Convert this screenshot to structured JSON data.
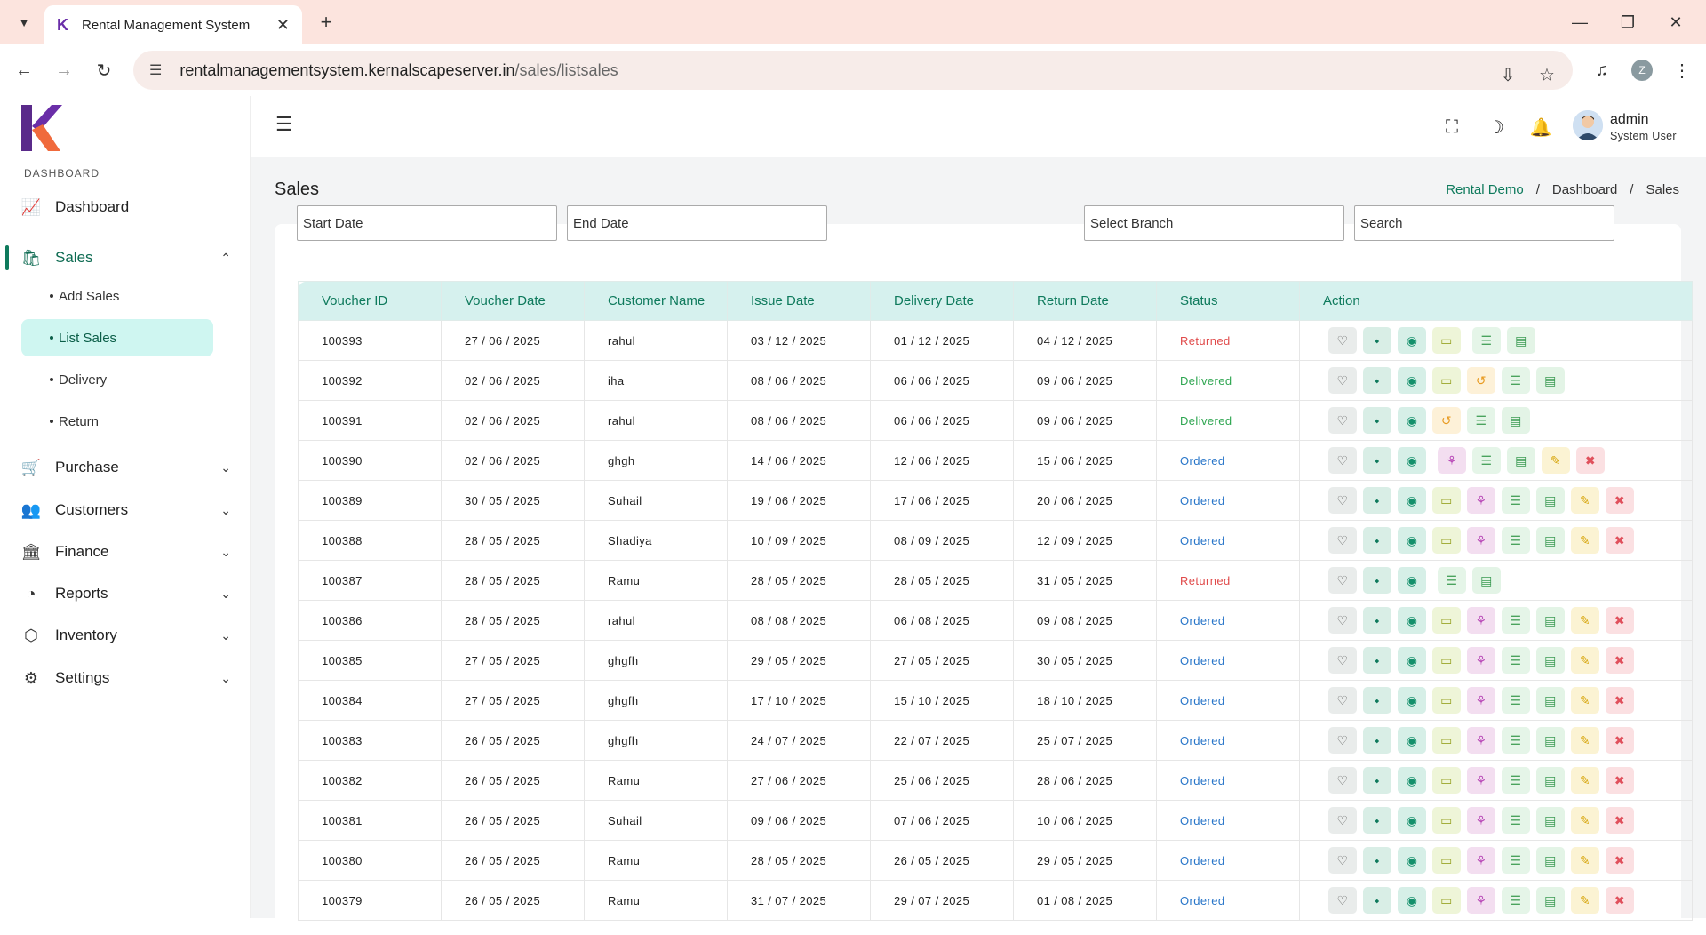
{
  "browser": {
    "tab_title": "Rental Management System",
    "url_host": "rentalmanagementsystem.kernalscapeserver.in",
    "url_path": "/sales/listsales",
    "profile_initial": "Z"
  },
  "sidebar": {
    "section_label": "DASHBOARD",
    "items": [
      {
        "label": "Dashboard",
        "icon": "chart-icon"
      },
      {
        "label": "Sales",
        "icon": "bag-icon",
        "expanded": true
      },
      {
        "label": "Purchase",
        "icon": "cart-icon"
      },
      {
        "label": "Customers",
        "icon": "users-icon"
      },
      {
        "label": "Finance",
        "icon": "bank-icon"
      },
      {
        "label": "Reports",
        "icon": "pie-icon"
      },
      {
        "label": "Inventory",
        "icon": "box-icon"
      },
      {
        "label": "Settings",
        "icon": "gear-icon"
      }
    ],
    "sales_sub": [
      "Add Sales",
      "List Sales",
      "Delivery",
      "Return"
    ]
  },
  "topbar": {
    "user_name": "admin",
    "user_role": "System User"
  },
  "page": {
    "title": "Sales",
    "breadcrumb": [
      "Rental Demo",
      "Dashboard",
      "Sales"
    ]
  },
  "filters": {
    "start_date": "Start Date",
    "end_date": "End Date",
    "branch": "Select Branch",
    "search": "Search"
  },
  "table": {
    "columns": [
      "Voucher ID",
      "Voucher Date",
      "Customer Name",
      "Issue Date",
      "Delivery Date",
      "Return Date",
      "Status",
      "Action"
    ],
    "rows": [
      {
        "id": "100393",
        "vdate": "27 / 06 / 2025",
        "customer": "rahul",
        "issue": "03 / 12 / 2025",
        "delivery": "01 / 12 / 2025",
        "ret": "04 / 12 / 2025",
        "status": "Returned",
        "actions": [
          "like",
          "share",
          "view",
          "pay",
          "gap",
          "list",
          "doc"
        ]
      },
      {
        "id": "100392",
        "vdate": "02 / 06 / 2025",
        "customer": "iha",
        "issue": "08 / 06 / 2025",
        "delivery": "06 / 06 / 2025",
        "ret": "09 / 06 / 2025",
        "status": "Delivered",
        "actions": [
          "like",
          "share",
          "view",
          "pay",
          "return",
          "list",
          "doc"
        ]
      },
      {
        "id": "100391",
        "vdate": "02 / 06 / 2025",
        "customer": "rahul",
        "issue": "08 / 06 / 2025",
        "delivery": "06 / 06 / 2025",
        "ret": "09 / 06 / 2025",
        "status": "Delivered",
        "actions": [
          "like",
          "share",
          "view",
          "return",
          "list",
          "doc"
        ]
      },
      {
        "id": "100390",
        "vdate": "02 / 06 / 2025",
        "customer": "ghgh",
        "issue": "14 / 06 / 2025",
        "delivery": "12 / 06 / 2025",
        "ret": "15 / 06 / 2025",
        "status": "Ordered",
        "actions": [
          "like",
          "share",
          "view",
          "gap",
          "deliver",
          "list",
          "doc",
          "edit",
          "del"
        ]
      },
      {
        "id": "100389",
        "vdate": "30 / 05 / 2025",
        "customer": "Suhail",
        "issue": "19 / 06 / 2025",
        "delivery": "17 / 06 / 2025",
        "ret": "20 / 06 / 2025",
        "status": "Ordered",
        "actions": [
          "like",
          "share",
          "view",
          "pay",
          "deliver",
          "list",
          "doc",
          "edit",
          "del"
        ]
      },
      {
        "id": "100388",
        "vdate": "28 / 05 / 2025",
        "customer": "Shadiya",
        "issue": "10 / 09 / 2025",
        "delivery": "08 / 09 / 2025",
        "ret": "12 / 09 / 2025",
        "status": "Ordered",
        "actions": [
          "like",
          "share",
          "view",
          "pay",
          "deliver",
          "list",
          "doc",
          "edit",
          "del"
        ]
      },
      {
        "id": "100387",
        "vdate": "28 / 05 / 2025",
        "customer": "Ramu",
        "issue": "28 / 05 / 2025",
        "delivery": "28 / 05 / 2025",
        "ret": "31 / 05 / 2025",
        "status": "Returned",
        "actions": [
          "like",
          "share",
          "view",
          "gap",
          "list",
          "doc"
        ]
      },
      {
        "id": "100386",
        "vdate": "28 / 05 / 2025",
        "customer": "rahul",
        "issue": "08 / 08 / 2025",
        "delivery": "06 / 08 / 2025",
        "ret": "09 / 08 / 2025",
        "status": "Ordered",
        "actions": [
          "like",
          "share",
          "view",
          "pay",
          "deliver",
          "list",
          "doc",
          "edit",
          "del"
        ]
      },
      {
        "id": "100385",
        "vdate": "27 / 05 / 2025",
        "customer": "ghgfh",
        "issue": "29 / 05 / 2025",
        "delivery": "27 / 05 / 2025",
        "ret": "30 / 05 / 2025",
        "status": "Ordered",
        "actions": [
          "like",
          "share",
          "view",
          "pay",
          "deliver",
          "list",
          "doc",
          "edit",
          "del"
        ]
      },
      {
        "id": "100384",
        "vdate": "27 / 05 / 2025",
        "customer": "ghgfh",
        "issue": "17 / 10 / 2025",
        "delivery": "15 / 10 / 2025",
        "ret": "18 / 10 / 2025",
        "status": "Ordered",
        "actions": [
          "like",
          "share",
          "view",
          "pay",
          "deliver",
          "list",
          "doc",
          "edit",
          "del"
        ]
      },
      {
        "id": "100383",
        "vdate": "26 / 05 / 2025",
        "customer": "ghgfh",
        "issue": "24 / 07 / 2025",
        "delivery": "22 / 07 / 2025",
        "ret": "25 / 07 / 2025",
        "status": "Ordered",
        "actions": [
          "like",
          "share",
          "view",
          "pay",
          "deliver",
          "list",
          "doc",
          "edit",
          "del"
        ]
      },
      {
        "id": "100382",
        "vdate": "26 / 05 / 2025",
        "customer": "Ramu",
        "issue": "27 / 06 / 2025",
        "delivery": "25 / 06 / 2025",
        "ret": "28 / 06 / 2025",
        "status": "Ordered",
        "actions": [
          "like",
          "share",
          "view",
          "pay",
          "deliver",
          "list",
          "doc",
          "edit",
          "del"
        ]
      },
      {
        "id": "100381",
        "vdate": "26 / 05 / 2025",
        "customer": "Suhail",
        "issue": "09 / 06 / 2025",
        "delivery": "07 / 06 / 2025",
        "ret": "10 / 06 / 2025",
        "status": "Ordered",
        "actions": [
          "like",
          "share",
          "view",
          "pay",
          "deliver",
          "list",
          "doc",
          "edit",
          "del"
        ]
      },
      {
        "id": "100380",
        "vdate": "26 / 05 / 2025",
        "customer": "Ramu",
        "issue": "28 / 05 / 2025",
        "delivery": "26 / 05 / 2025",
        "ret": "29 / 05 / 2025",
        "status": "Ordered",
        "actions": [
          "like",
          "share",
          "view",
          "pay",
          "deliver",
          "list",
          "doc",
          "edit",
          "del"
        ]
      },
      {
        "id": "100379",
        "vdate": "26 / 05 / 2025",
        "customer": "Ramu",
        "issue": "31 / 07 / 2025",
        "delivery": "29 / 07 / 2025",
        "ret": "01 / 08 / 2025",
        "status": "Ordered",
        "actions": [
          "like",
          "share",
          "view",
          "pay",
          "deliver",
          "list",
          "doc",
          "edit",
          "del"
        ]
      }
    ]
  }
}
